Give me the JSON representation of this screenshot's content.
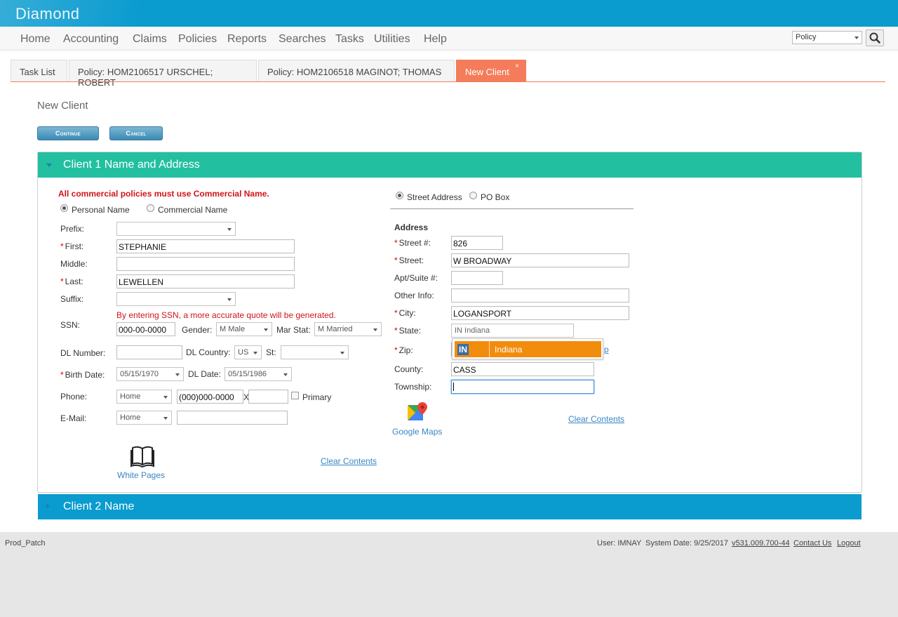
{
  "app": {
    "brand": "Diamond"
  },
  "nav": {
    "items": [
      "Home",
      "Accounting",
      "Claims",
      "Policies",
      "Reports",
      "Searches",
      "Tasks",
      "Utilities",
      "Help"
    ],
    "search_scope": "Policy"
  },
  "tabs": [
    {
      "label": "Task List"
    },
    {
      "label": "Policy: HOM2106517 URSCHEL; ROBERT"
    },
    {
      "label": "Policy: HOM2106518 MAGINOT; THOMAS"
    },
    {
      "label": "New Client",
      "close": "×"
    }
  ],
  "page": {
    "title": "New Client",
    "continue_label": "Continue",
    "cancel_label": "Cancel"
  },
  "panel1": {
    "title": "Client 1 Name and Address",
    "warning": "All commercial policies must use Commercial Name.",
    "name_type": {
      "personal": "Personal Name",
      "commercial": "Commercial Name"
    },
    "fields": {
      "prefix": {
        "label": "Prefix:",
        "value": ""
      },
      "first": {
        "label": "First:",
        "value": "STEPHANIE"
      },
      "middle": {
        "label": "Middle:",
        "value": ""
      },
      "last": {
        "label": "Last:",
        "value": "LEWELLEN"
      },
      "suffix": {
        "label": "Suffix:",
        "value": ""
      },
      "ssn_note": "By entering SSN, a more accurate quote will be generated.",
      "ssn": {
        "label": "SSN:",
        "value": "000-00-0000"
      },
      "gender": {
        "label": "Gender:",
        "value": "M Male"
      },
      "mar_stat": {
        "label": "Mar Stat:",
        "value": "M Married"
      },
      "dl_number": {
        "label": "DL Number:",
        "value": ""
      },
      "dl_country": {
        "label": "DL Country:",
        "value": "US"
      },
      "dl_state": {
        "label": "St:",
        "value": ""
      },
      "birth_date": {
        "label": "Birth Date:",
        "value": "05/15/1970"
      },
      "dl_date": {
        "label": "DL Date:",
        "value": "05/15/1986"
      },
      "phone": {
        "label": "Phone:",
        "type": "Home",
        "value": "(000)000-0000",
        "ext_sep": "X",
        "ext": "",
        "primary": "Primary"
      },
      "email": {
        "label": "E-Mail:",
        "type": "Home",
        "value": ""
      }
    },
    "white_pages": "White Pages",
    "clear_left": "Clear Contents",
    "address_type": {
      "street": "Street Address",
      "po": "PO Box"
    },
    "address": {
      "heading": "Address",
      "street_num": {
        "label": "Street #:",
        "value": "826"
      },
      "street": {
        "label": "Street:",
        "value": "W BROADWAY"
      },
      "apt": {
        "label": "Apt/Suite #:",
        "value": ""
      },
      "other": {
        "label": "Other Info:",
        "value": ""
      },
      "city": {
        "label": "City:",
        "value": "LOGANSPORT"
      },
      "state": {
        "label": "State:",
        "value": "IN Indiana"
      },
      "zip": {
        "label": "Zip:",
        "value": ""
      },
      "zip_link_fragment": "p",
      "county": {
        "label": "County:",
        "value": "CASS"
      },
      "township": {
        "label": "Township:",
        "value": ""
      }
    },
    "state_dropdown": {
      "code": "IN",
      "name": "Indiana"
    },
    "google_maps": "Google Maps",
    "clear_right": "Clear Contents"
  },
  "panel2": {
    "title": "Client 2 Name"
  },
  "footer": {
    "env": "Prod_Patch",
    "user": "User: IMNAY",
    "system_date": "System Date: 9/25/2017",
    "version": "v531.009.700-44",
    "contact": "Contact Us",
    "logout": "Logout"
  },
  "colors": {
    "header": "#0a9bcf",
    "panel_head": "#22bfa0",
    "active_tab": "#f47c5a",
    "dropdown_highlight": "#f28c0c"
  }
}
